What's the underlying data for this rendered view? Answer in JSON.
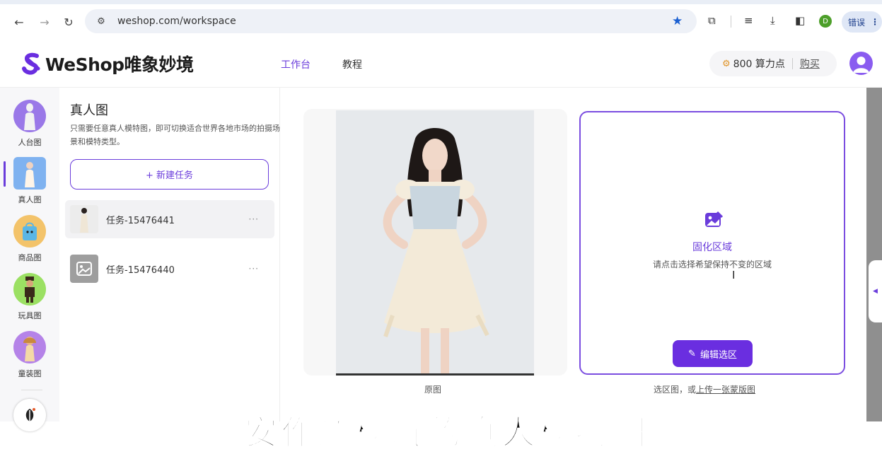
{
  "browser": {
    "url": "weshop.com/workspace",
    "error_label": "错误",
    "profile_initial": "D"
  },
  "header": {
    "logo_text": "WeShop唯象妙境",
    "nav": [
      {
        "label": "工作台",
        "active": true
      },
      {
        "label": "教程",
        "active": false
      }
    ],
    "credits": "800 算力点",
    "buy_label": "购买"
  },
  "rail": {
    "items": [
      {
        "label": "人台图",
        "icon": "mannequin-icon"
      },
      {
        "label": "真人图",
        "icon": "model-photo-icon",
        "active": true
      },
      {
        "label": "商品图",
        "icon": "product-bag-icon"
      },
      {
        "label": "玩具图",
        "icon": "toy-figure-icon"
      },
      {
        "label": "童装图",
        "icon": "kids-clothing-icon"
      }
    ]
  },
  "panel": {
    "title": "真人图",
    "description": "只需要任意真人模特图，即可切换适合世界各地市场的拍摄场景和模特类型。",
    "new_task_label": "+ 新建任务",
    "tasks": [
      {
        "name": "任务-15476441",
        "selected": true,
        "more": "···"
      },
      {
        "name": "任务-15476440",
        "selected": false,
        "more": "···"
      }
    ]
  },
  "workspace": {
    "original_caption": "原图",
    "selection_title": "固化区域",
    "selection_desc": "请点击选择希望保持不变的区域",
    "edit_button": "编辑选区",
    "selection_caption_prefix": "选区图，或",
    "selection_caption_link": "上传一张蒙版图"
  },
  "subtitle": "安作道模玩的真人模特图",
  "colors": {
    "accent": "#6a3cdb",
    "button": "#6a2ee0"
  }
}
